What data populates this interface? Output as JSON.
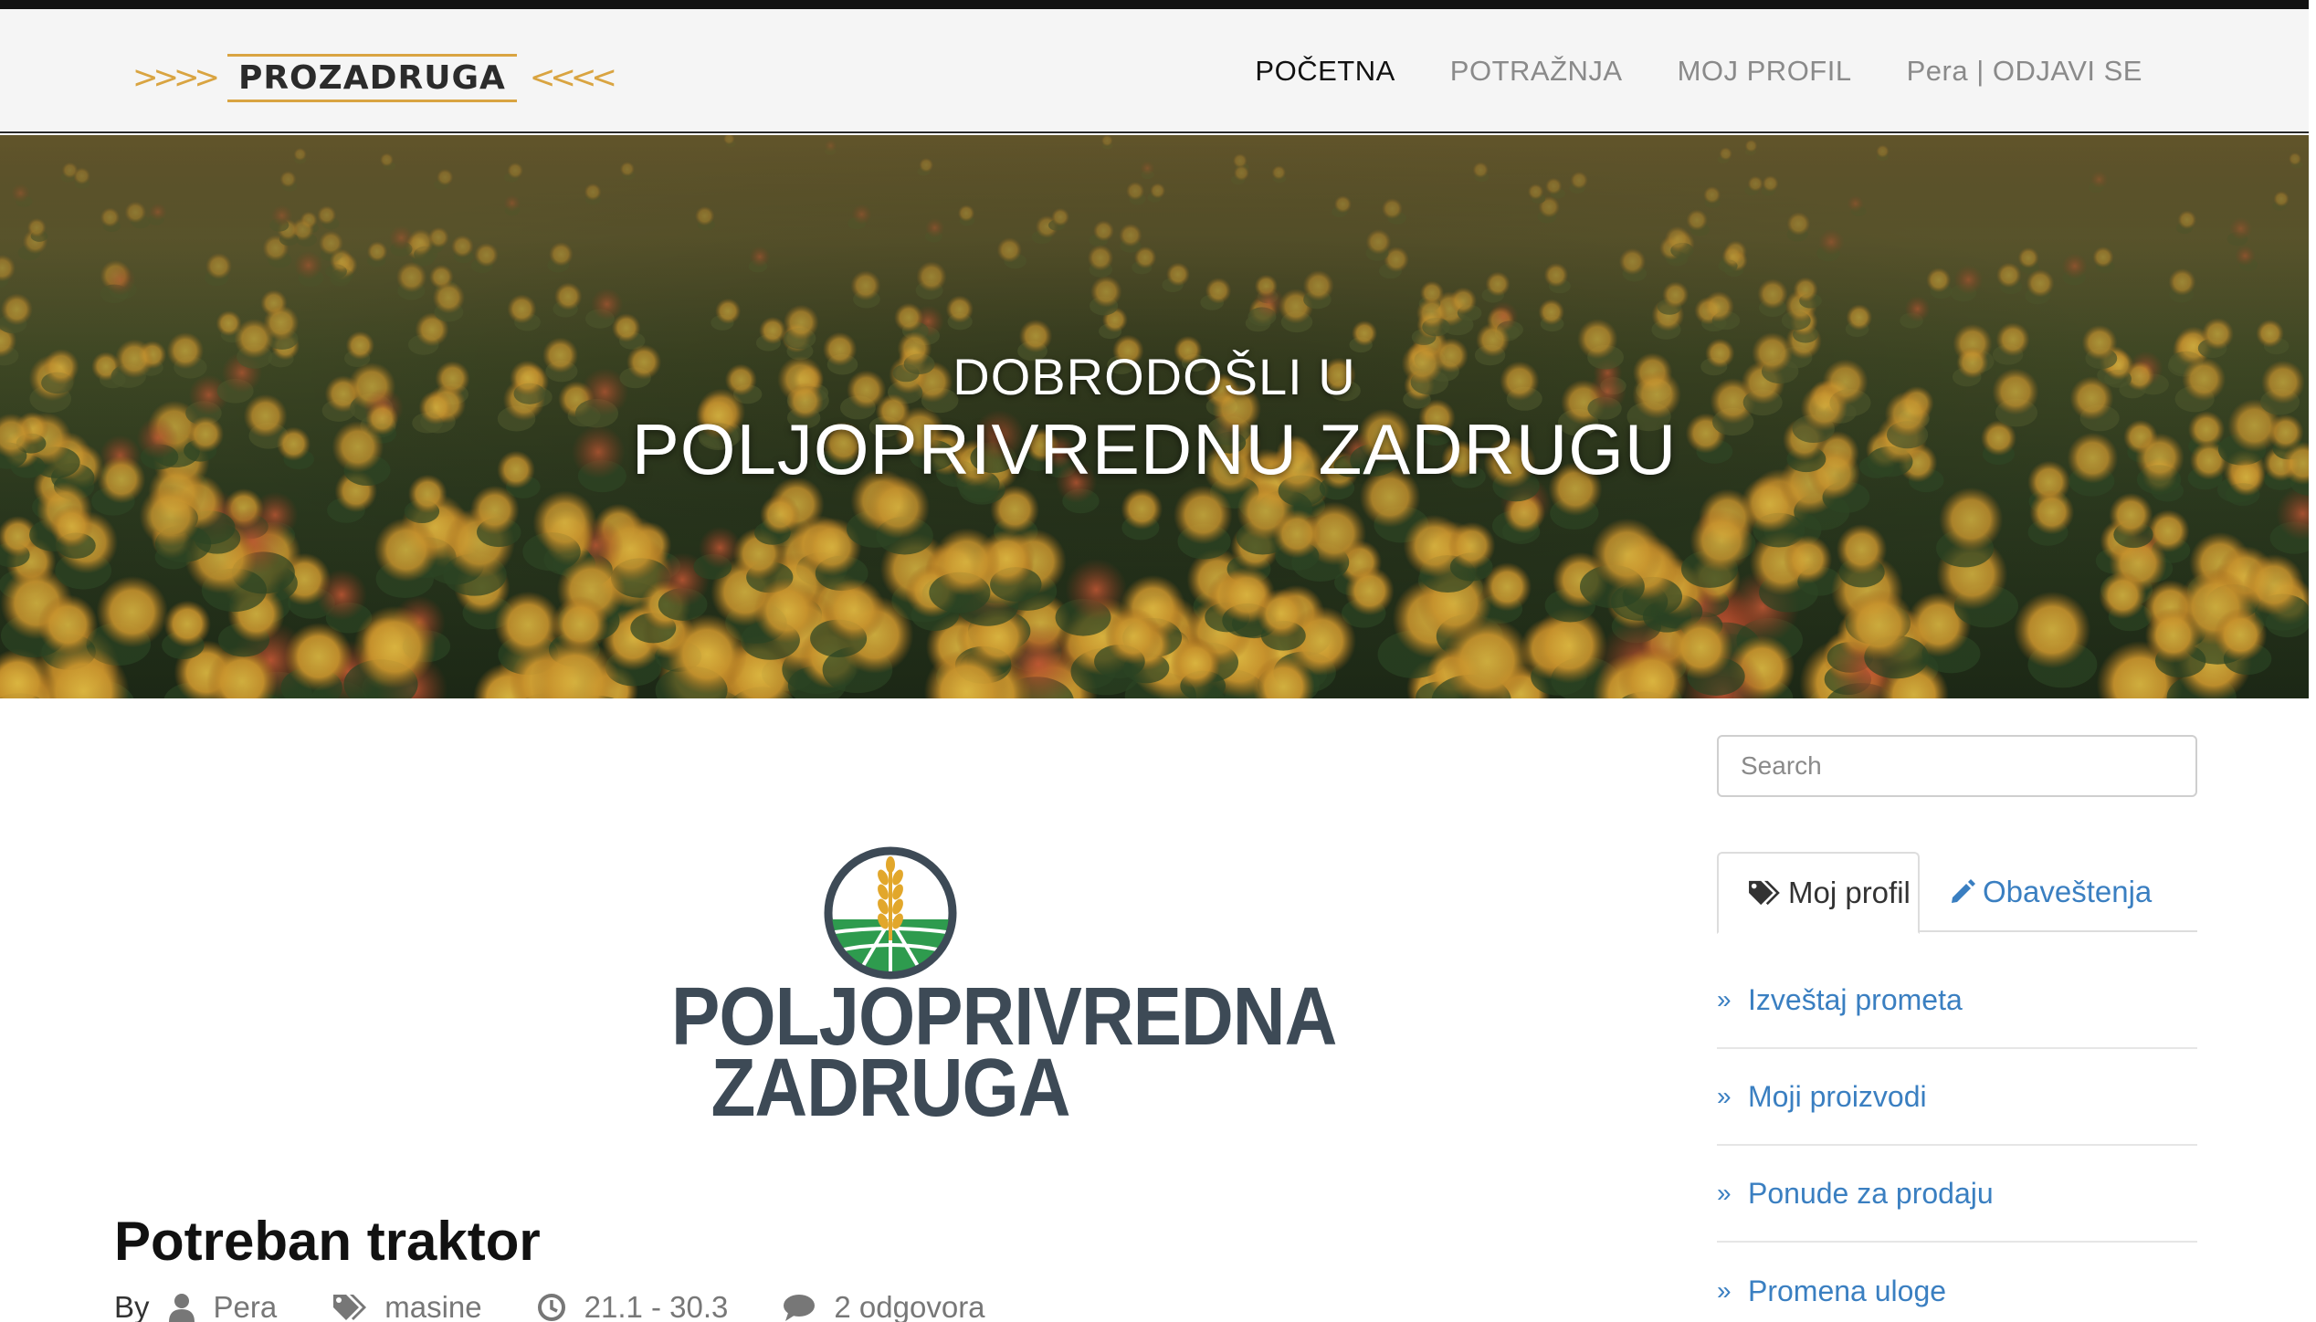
{
  "navbar": {
    "brand": "PROZADRUGA",
    "items": [
      {
        "label": "POČETNA",
        "active": true
      },
      {
        "label": "POTRAŽNJA",
        "active": false
      },
      {
        "label": "MOJ PROFIL",
        "active": false
      },
      {
        "label": "Pera | ODJAVI SE",
        "active": false
      }
    ]
  },
  "hero": {
    "line1": "DOBRODOŠLI U",
    "line2": "POLJOPRIVREDNU ZADRUGU"
  },
  "logo": {
    "line1": "POLJOPRIVREDNA",
    "line2": "ZADRUGA"
  },
  "post": {
    "title": "Potreban traktor",
    "by": "By",
    "author": "Pera",
    "tag": "masine",
    "date": "21.1 - 30.3",
    "replies": "2 odgovora"
  },
  "sidebar": {
    "search_placeholder": "Search",
    "tabs": [
      {
        "label": "Moj profil",
        "icon": "tags-icon",
        "active": true
      },
      {
        "label": "Obaveštenja",
        "icon": "pencil-icon",
        "active": false
      }
    ],
    "links": [
      "Izveštaj prometa",
      "Moji proizvodi",
      "Ponude za prodaju",
      "Promena uloge"
    ]
  },
  "colors": {
    "link": "#3a7fc1",
    "accent_gold": "#d9a441",
    "logo_dark": "#3d4a56",
    "logo_green": "#2e9b4e"
  }
}
